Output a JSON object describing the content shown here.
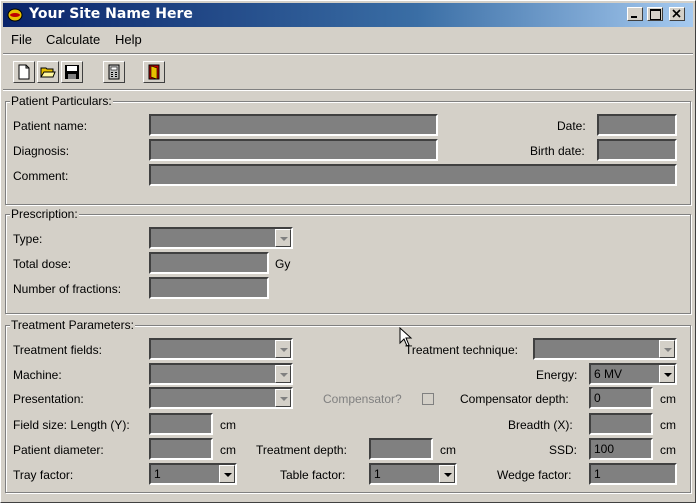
{
  "window": {
    "title": "Your Site Name Here"
  },
  "menu": {
    "file": "File",
    "calculate": "Calculate",
    "help": "Help"
  },
  "patient": {
    "legend": "Patient Particulars:",
    "name_label": "Patient name:",
    "diagnosis_label": "Diagnosis:",
    "comment_label": "Comment:",
    "date_label": "Date:",
    "birth_label": "Birth date:"
  },
  "prescription": {
    "legend": "Prescription:",
    "type_label": "Type:",
    "dose_label": "Total dose:",
    "dose_unit": "Gy",
    "fractions_label": "Number of fractions:"
  },
  "treatment": {
    "legend": "Treatment Parameters:",
    "fields_label": "Treatment fields:",
    "technique_label": "Treatment technique:",
    "machine_label": "Machine:",
    "energy_label": "Energy:",
    "energy_value": "6 MV",
    "presentation_label": "Presentation:",
    "compensator_label": "Compensator?",
    "comp_depth_label": "Compensator depth:",
    "comp_depth_value": "0",
    "field_length_label": "Field size: Length (Y):",
    "breadth_label": "Breadth (X):",
    "diameter_label": "Patient diameter:",
    "depth_label": "Treatment depth:",
    "ssd_label": "SSD:",
    "ssd_value": "100",
    "tray_label": "Tray factor:",
    "tray_value": "1",
    "table_label": "Table factor:",
    "table_value": "1",
    "wedge_label": "Wedge factor:",
    "wedge_value": "1",
    "unit_cm": "cm"
  }
}
